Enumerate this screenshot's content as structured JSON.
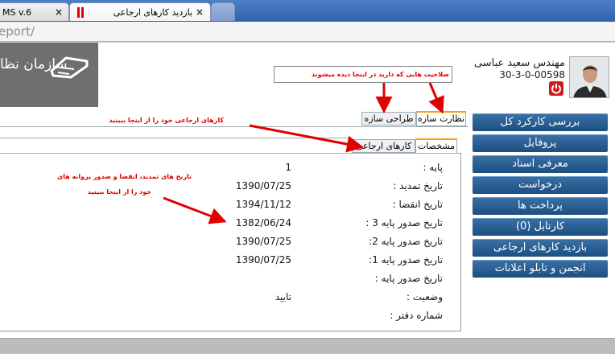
{
  "browser": {
    "tabs": [
      {
        "label": "MS v.6"
      },
      {
        "label": "بازدید کارهای ارجاعی"
      }
    ],
    "tab_close": "×",
    "url": "eport/"
  },
  "header": {
    "org_name": "سازمان نظا",
    "user_name": "مهندس سعید عباسی",
    "user_code": "30-3-0-00598"
  },
  "sidebar": {
    "items": [
      {
        "label": "بررسی کارکرد کل"
      },
      {
        "label": "پروفایل"
      },
      {
        "label": "معرفی اسناد"
      },
      {
        "label": "درخواست"
      },
      {
        "label": "پرداخت ها"
      },
      {
        "label": "کارتابل (0)"
      },
      {
        "label": "بازدید کارهای ارجاعی"
      },
      {
        "label": "انجمن و تابلو اعلانات"
      }
    ]
  },
  "tabs": {
    "supervision": "نظارت سازه",
    "design": "طراحی سازه"
  },
  "subtabs": {
    "spec": "مشخصات",
    "refer": "کارهای ارجاعی"
  },
  "details": {
    "rows": [
      {
        "label": "پایه :",
        "value": "1"
      },
      {
        "label": "تاریخ تمدید :",
        "value": "1390/07/25"
      },
      {
        "label": "تاریخ انقضا :",
        "value": "1394/11/12"
      },
      {
        "label": "تاریخ صدور پایه 3 :",
        "value": "1382/06/24"
      },
      {
        "label": "تاریخ صدور پایه 2:",
        "value": "1390/07/25"
      },
      {
        "label": "تاریخ صدور پایه 1:",
        "value": "1390/07/25"
      },
      {
        "label": "تاریخ صدور پایه :",
        "value": ""
      },
      {
        "label": "وضعیت :",
        "value": "تایید"
      },
      {
        "label": "شماره دفتر :",
        "value": ""
      }
    ]
  },
  "annotations": {
    "top": "صلاحیت هایی که دارید در اینجا دیده میشوند",
    "refer": "کارهای ارجاعی خود را از اینجا ببینید",
    "dates_line1": "تاریخ های تمدید، انقضا و صدور پروانه های",
    "dates_line2": "خود را از اینجا ببینید"
  },
  "colors": {
    "sidebar_bg": "#1c4f82",
    "active_tab_accent": "#f3a312",
    "annotation": "#e00000",
    "power": "#d21a1a"
  }
}
